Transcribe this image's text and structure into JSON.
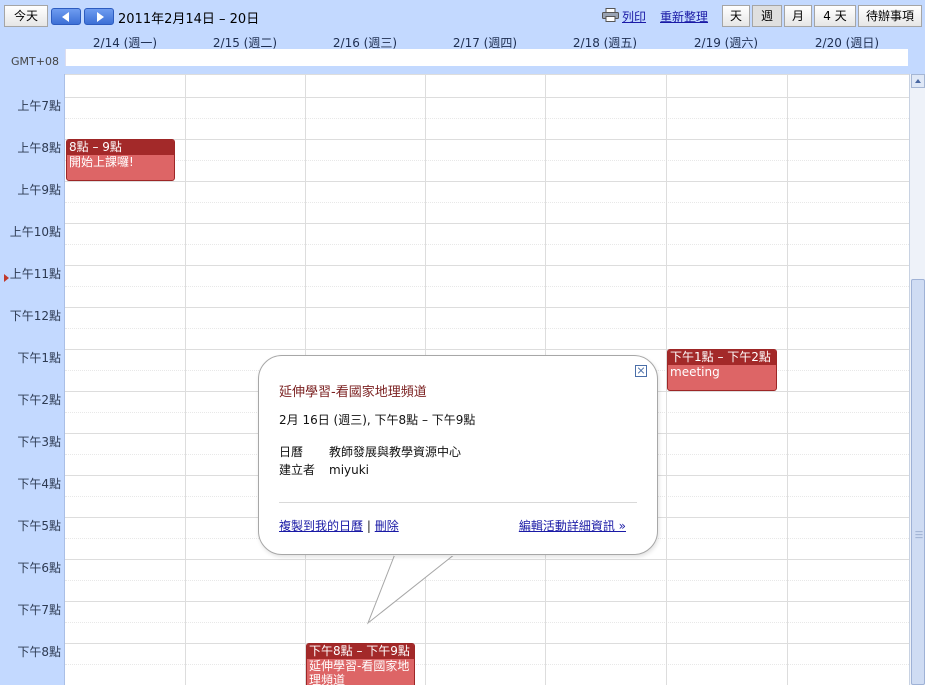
{
  "toolbar": {
    "today": "今天",
    "date_range": "2011年2月14日 – 20日",
    "print": "列印",
    "refresh": "重新整理",
    "views": [
      "天",
      "週",
      "月",
      "4 天",
      "待辦事項"
    ]
  },
  "header": {
    "timezone": "GMT+08",
    "days": [
      "2/14 (週一)",
      "2/15 (週二)",
      "2/16 (週三)",
      "2/17 (週四)",
      "2/18 (週五)",
      "2/19 (週六)",
      "2/20 (週日)"
    ]
  },
  "times": [
    "上午7點",
    "上午8點",
    "上午9點",
    "上午10點",
    "上午11點",
    "下午12點",
    "下午1點",
    "下午2點",
    "下午3點",
    "下午4點",
    "下午5點",
    "下午6點",
    "下午7點",
    "下午8點"
  ],
  "events": [
    {
      "time": "8點 – 9點",
      "title": "開始上課囉!"
    },
    {
      "time": "下午1點 – 下午2點",
      "title": "meeting"
    },
    {
      "time": "下午8點 – 下午9點",
      "title": "延伸學習-看國家地理頻道"
    }
  ],
  "popup": {
    "title": "延伸學習-看國家地理頻道",
    "datetime": "2月 16日 (週三), 下午8點 – 下午9點",
    "calendar_label": "日曆",
    "calendar_value": "教師發展與教學資源中心",
    "creator_label": "建立者",
    "creator_value": "miyuki",
    "copy_link": "複製到我的日曆",
    "separator": "|",
    "delete_link": "刪除",
    "edit_link": "編輯活動詳細資訊 »"
  },
  "colors": {
    "header_bg": "#c3d9ff",
    "event_bg": "#dd6566",
    "event_header": "#a32929",
    "link": "#1a1aa6"
  }
}
